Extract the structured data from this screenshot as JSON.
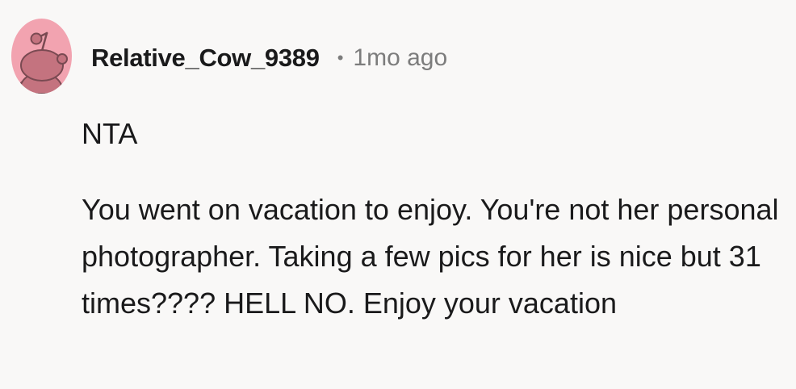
{
  "comment": {
    "author": "Relative_Cow_9389",
    "separator": "•",
    "timestamp": "1mo ago",
    "paragraphs": [
      "NTA",
      "You went on vacation to enjoy. You're not her personal photographer. Taking a few pics for her is nice but 31 times???? HELL NO. Enjoy your vacation"
    ]
  },
  "avatar": {
    "icon": "snoo-avatar-icon",
    "background": "#f2a3b0",
    "figure_color": "#c4737f"
  }
}
